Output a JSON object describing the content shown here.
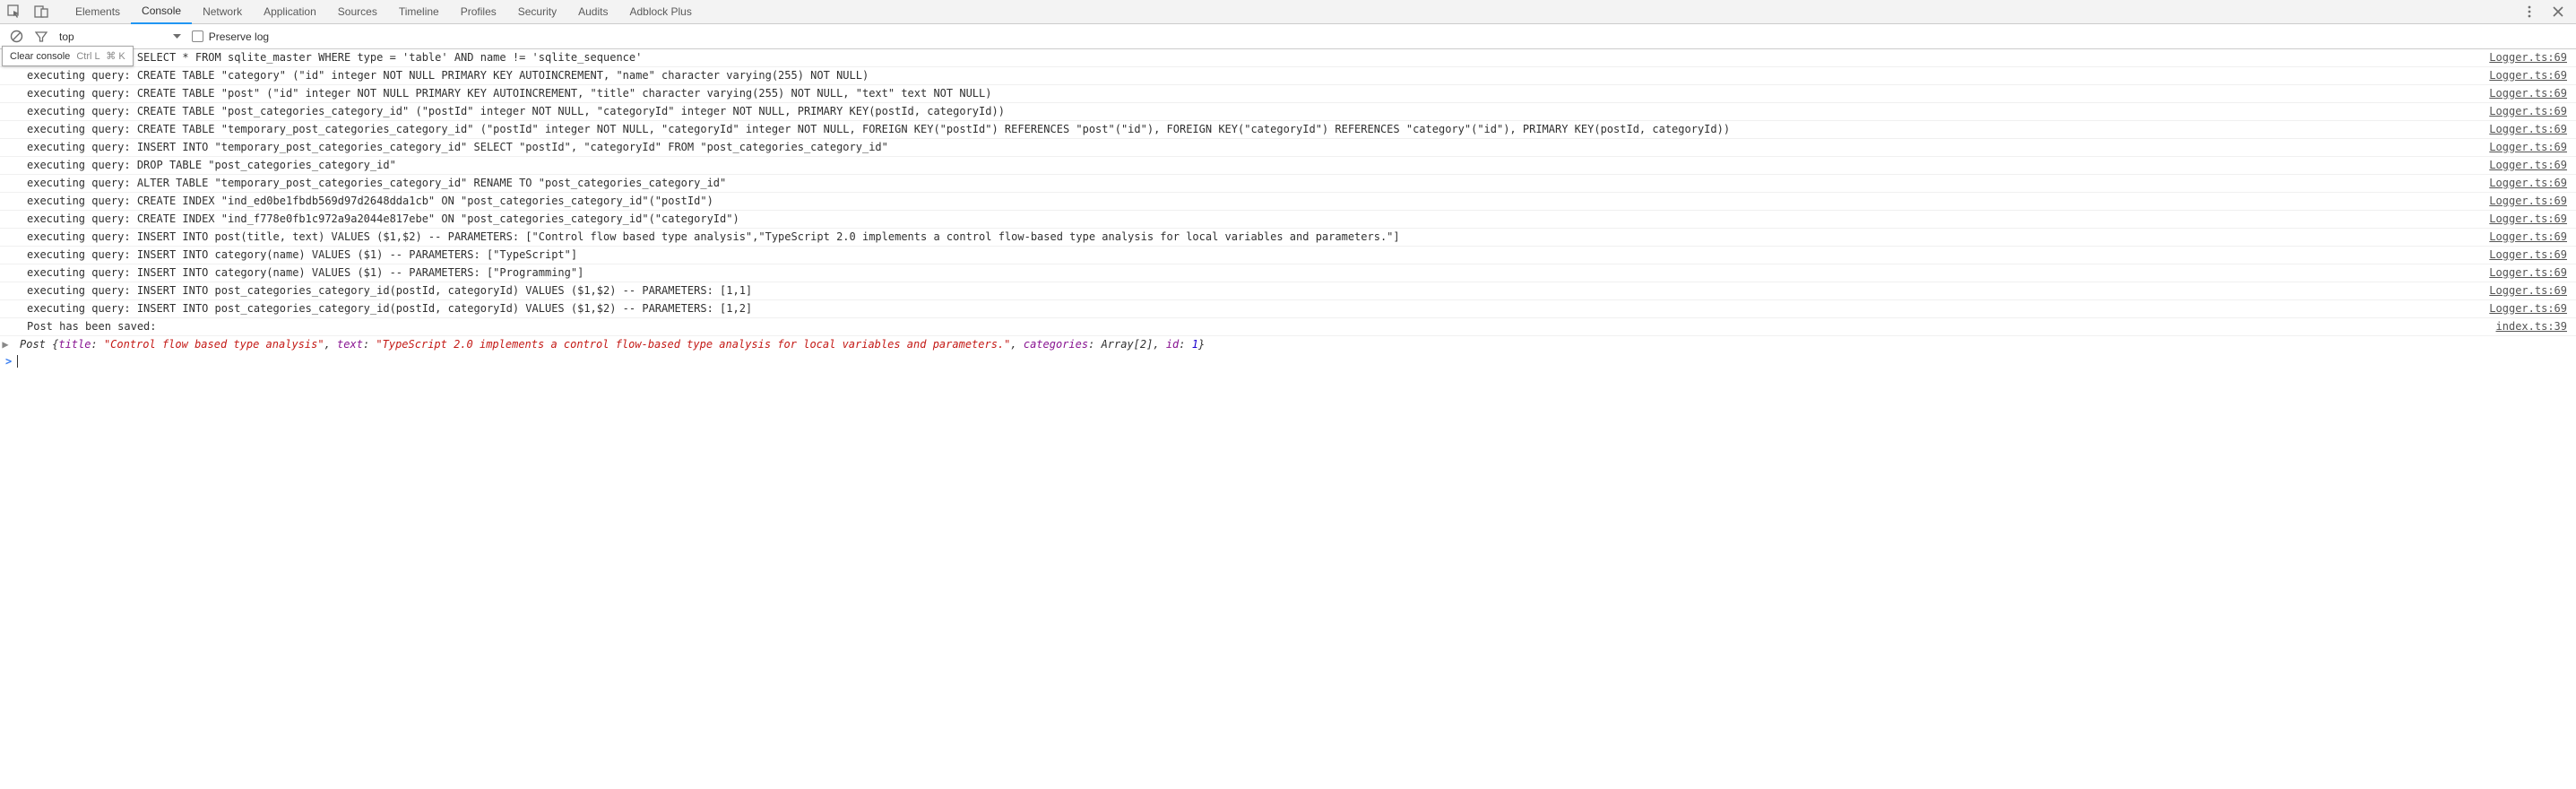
{
  "toolbar": {
    "tabs": [
      "Elements",
      "Console",
      "Network",
      "Application",
      "Sources",
      "Timeline",
      "Profiles",
      "Security",
      "Audits",
      "Adblock Plus"
    ],
    "activeTab": "Console"
  },
  "subbar": {
    "context": "top",
    "preserve_log_label": "Preserve log"
  },
  "tooltip": {
    "label": "Clear console",
    "shortcut1": "Ctrl L",
    "shortcut2": "⌘ K"
  },
  "logs": [
    {
      "msg": "executing query: SELECT * FROM sqlite_master WHERE type = 'table' AND name != 'sqlite_sequence'",
      "src": "Logger.ts:69"
    },
    {
      "msg": "executing query: CREATE TABLE \"category\" (\"id\" integer NOT NULL PRIMARY KEY AUTOINCREMENT, \"name\" character varying(255) NOT NULL)",
      "src": "Logger.ts:69"
    },
    {
      "msg": "executing query: CREATE TABLE \"post\" (\"id\" integer NOT NULL PRIMARY KEY AUTOINCREMENT, \"title\" character varying(255) NOT NULL, \"text\" text NOT NULL)",
      "src": "Logger.ts:69"
    },
    {
      "msg": "executing query: CREATE TABLE \"post_categories_category_id\" (\"postId\" integer NOT NULL, \"categoryId\" integer NOT NULL, PRIMARY KEY(postId, categoryId))",
      "src": "Logger.ts:69"
    },
    {
      "msg": "executing query: CREATE TABLE \"temporary_post_categories_category_id\" (\"postId\" integer NOT NULL, \"categoryId\" integer NOT NULL, FOREIGN KEY(\"postId\") REFERENCES \"post\"(\"id\"), FOREIGN KEY(\"categoryId\") REFERENCES \"category\"(\"id\"), PRIMARY KEY(postId, categoryId))",
      "src": "Logger.ts:69"
    },
    {
      "msg": "executing query: INSERT INTO \"temporary_post_categories_category_id\" SELECT \"postId\", \"categoryId\" FROM \"post_categories_category_id\"",
      "src": "Logger.ts:69"
    },
    {
      "msg": "executing query: DROP TABLE \"post_categories_category_id\"",
      "src": "Logger.ts:69"
    },
    {
      "msg": "executing query: ALTER TABLE \"temporary_post_categories_category_id\" RENAME TO \"post_categories_category_id\"",
      "src": "Logger.ts:69"
    },
    {
      "msg": "executing query: CREATE INDEX \"ind_ed0be1fbdb569d97d2648dda1cb\" ON \"post_categories_category_id\"(\"postId\")",
      "src": "Logger.ts:69"
    },
    {
      "msg": "executing query: CREATE INDEX \"ind_f778e0fb1c972a9a2044e817ebe\" ON \"post_categories_category_id\"(\"categoryId\")",
      "src": "Logger.ts:69"
    },
    {
      "msg": "executing query: INSERT INTO post(title, text) VALUES ($1,$2) -- PARAMETERS: [\"Control flow based type analysis\",\"TypeScript 2.0 implements a control flow-based type analysis for local variables and parameters.\"]",
      "src": "Logger.ts:69"
    },
    {
      "msg": "executing query: INSERT INTO category(name) VALUES ($1) -- PARAMETERS: [\"TypeScript\"]",
      "src": "Logger.ts:69"
    },
    {
      "msg": "executing query: INSERT INTO category(name) VALUES ($1) -- PARAMETERS: [\"Programming\"]",
      "src": "Logger.ts:69"
    },
    {
      "msg": "executing query: INSERT INTO post_categories_category_id(postId, categoryId) VALUES ($1,$2) -- PARAMETERS: [1,1]",
      "src": "Logger.ts:69"
    },
    {
      "msg": "executing query: INSERT INTO post_categories_category_id(postId, categoryId) VALUES ($1,$2) -- PARAMETERS: [1,2]",
      "src": "Logger.ts:69"
    },
    {
      "msg": "Post has been saved:",
      "src": "index.ts:39"
    }
  ],
  "object_preview": {
    "class": "Post",
    "title_key": "title",
    "title_val": "\"Control flow based type analysis\"",
    "text_key": "text",
    "text_val": "\"TypeScript 2.0 implements a control flow-based type analysis for local variables and parameters.\"",
    "cat_key": "categories",
    "cat_val": "Array[2]",
    "id_key": "id",
    "id_val": "1"
  }
}
